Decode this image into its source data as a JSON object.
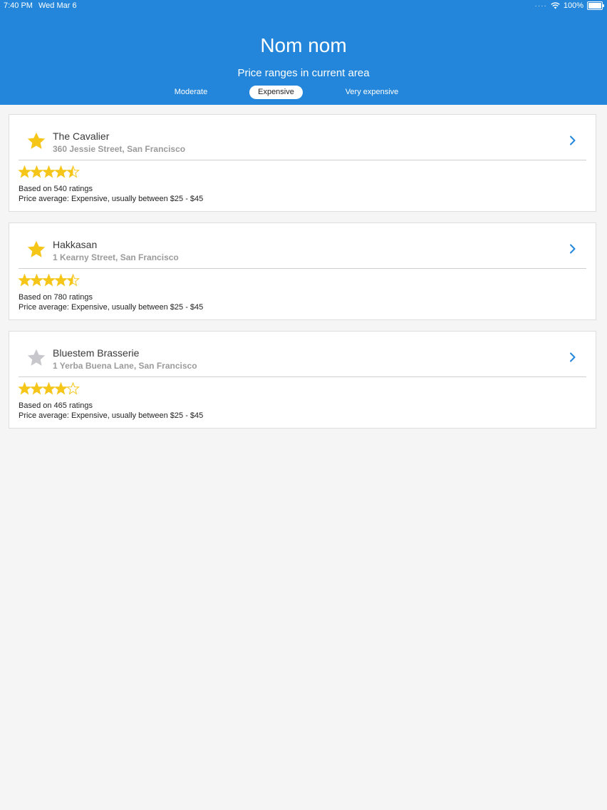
{
  "status_bar": {
    "time": "7:40 PM",
    "date": "Wed Mar 6",
    "battery": "100%",
    "battery_level": 1.0
  },
  "header": {
    "title": "Nom nom",
    "subtitle": "Price ranges in current area"
  },
  "tabs": [
    {
      "label": "Moderate",
      "active": false
    },
    {
      "label": "Expensive",
      "active": true
    },
    {
      "label": "Very expensive",
      "active": false
    }
  ],
  "colors": {
    "header_bg": "#2386da",
    "star_gold": "#f5c518",
    "star_grey": "#c7c7cc",
    "chevron": "#2386da"
  },
  "icons": {
    "favorite": "star-icon",
    "navigate": "chevron-right-icon",
    "wifi": "wifi-icon",
    "battery": "battery-icon"
  },
  "restaurants": [
    {
      "name": "The Cavalier",
      "address": "360 Jessie Street, San Francisco",
      "favorite": true,
      "rating": 4.5,
      "ratings_count_text": "Based on 540 ratings",
      "price_text": "Price average: Expensive, usually between $25 - $45"
    },
    {
      "name": "Hakkasan",
      "address": "1 Kearny Street, San Francisco",
      "favorite": true,
      "rating": 4.5,
      "ratings_count_text": "Based on 780 ratings",
      "price_text": "Price average: Expensive, usually between $25 - $45"
    },
    {
      "name": "Bluestem Brasserie",
      "address": "1 Yerba Buena Lane, San Francisco",
      "favorite": false,
      "rating": 4,
      "ratings_count_text": "Based on 465 ratings",
      "price_text": "Price average: Expensive, usually between $25 - $45"
    }
  ]
}
